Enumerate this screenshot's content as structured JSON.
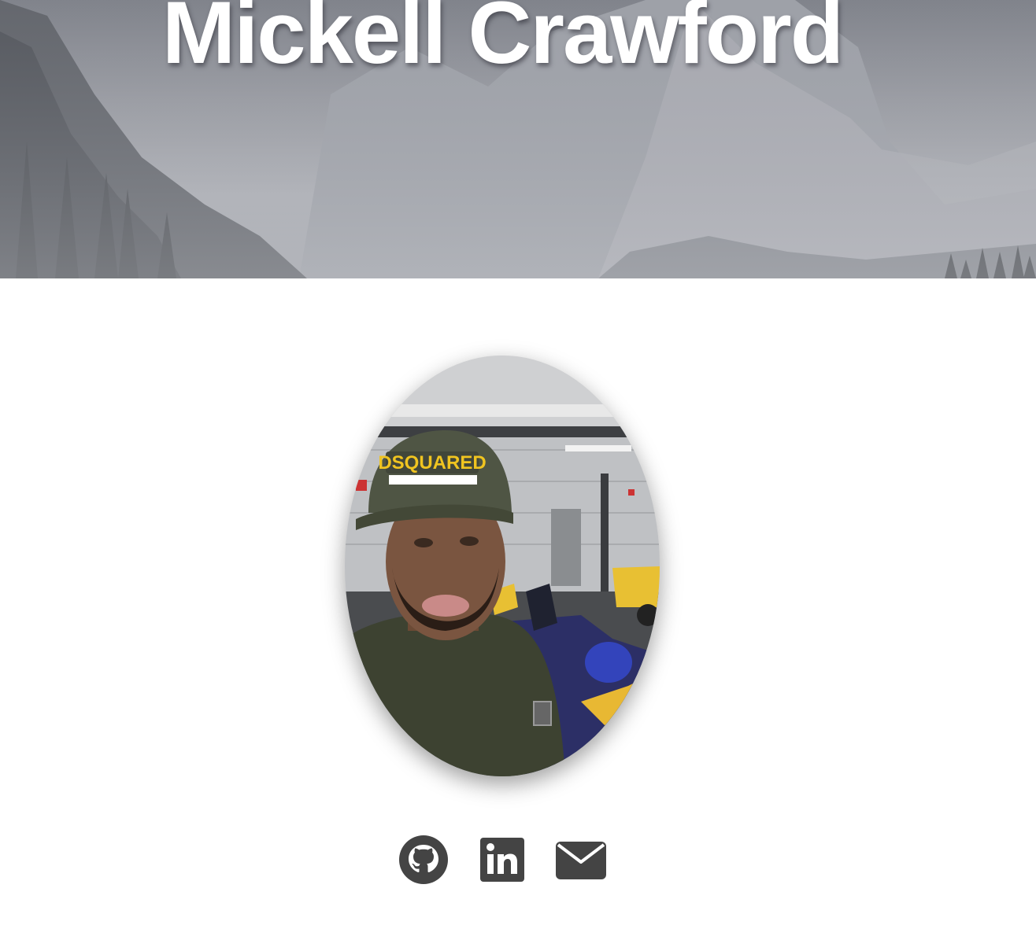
{
  "header": {
    "name": "Mickell Crawford"
  },
  "profile": {
    "avatar_icon": "profile-photo"
  },
  "social": {
    "links": [
      {
        "icon": "github-icon"
      },
      {
        "icon": "linkedin-icon"
      },
      {
        "icon": "envelope-icon"
      }
    ]
  },
  "colors": {
    "icon": "#444444",
    "background": "#ffffff",
    "title": "#ffffff"
  }
}
